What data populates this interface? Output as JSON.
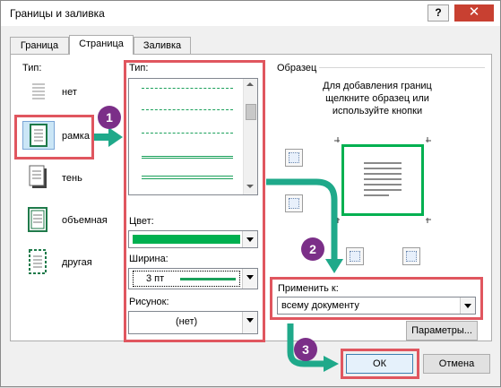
{
  "window": {
    "title": "Границы и заливка",
    "help_label": "?",
    "close_label": "✕"
  },
  "tabs": [
    {
      "label": "Граница"
    },
    {
      "label": "Страница"
    },
    {
      "label": "Заливка"
    }
  ],
  "settings": {
    "header": "Тип:",
    "items": [
      {
        "label": "нет"
      },
      {
        "label": "рамка"
      },
      {
        "label": "тень"
      },
      {
        "label": "объемная"
      },
      {
        "label": "другая"
      }
    ],
    "selected": "рамка"
  },
  "style": {
    "header": "Тип:",
    "color_label": "Цвет:",
    "color_value": "#00b050",
    "width_label": "Ширина:",
    "width_value": "3 пт",
    "art_label": "Рисунок:",
    "art_value": "(нет)"
  },
  "preview": {
    "header": "Образец",
    "instructions_line1": "Для добавления границ",
    "instructions_line2": "щелкните образец или",
    "instructions_line3": "используйте кнопки",
    "border_color": "#00b050"
  },
  "apply": {
    "label": "Применить к:",
    "value": "всему документу"
  },
  "buttons": {
    "options": "Параметры...",
    "ok": "ОК",
    "cancel": "Отмена"
  },
  "annotations": {
    "badge1": "1",
    "badge2": "2",
    "badge3": "3",
    "highlight_color": "#e0565f",
    "arrow_color": "#1fa98a",
    "badge_color": "#7b2f88"
  }
}
